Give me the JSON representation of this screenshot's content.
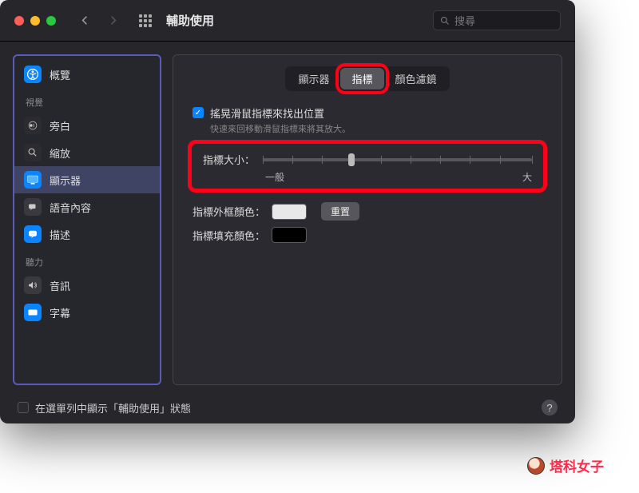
{
  "window": {
    "title": "輔助使用",
    "search_placeholder": "搜尋"
  },
  "sidebar": {
    "items": [
      {
        "label": "概覽"
      },
      {
        "section": "視覺"
      },
      {
        "label": "旁白"
      },
      {
        "label": "縮放"
      },
      {
        "label": "顯示器",
        "selected": true
      },
      {
        "label": "語音內容"
      },
      {
        "label": "描述"
      },
      {
        "section": "聽力"
      },
      {
        "label": "音訊"
      },
      {
        "label": "字幕"
      }
    ]
  },
  "tabs": {
    "display": "顯示器",
    "pointer": "指標",
    "color_filter": "顏色濾鏡",
    "active": "指標"
  },
  "shake": {
    "label": "搖晃滑鼠指標來找出位置",
    "desc": "快速來回移動滑鼠指標來將其放大。"
  },
  "slider": {
    "label": "指標大小：",
    "min_label": "一般",
    "max_label": "大",
    "value_percent": 33
  },
  "outline": {
    "label": "指標外框顏色：",
    "reset": "重置"
  },
  "fill": {
    "label": "指標填充顏色："
  },
  "footer": {
    "label": "在選單列中顯示「輔助使用」狀態"
  },
  "watermark": "塔科女子"
}
